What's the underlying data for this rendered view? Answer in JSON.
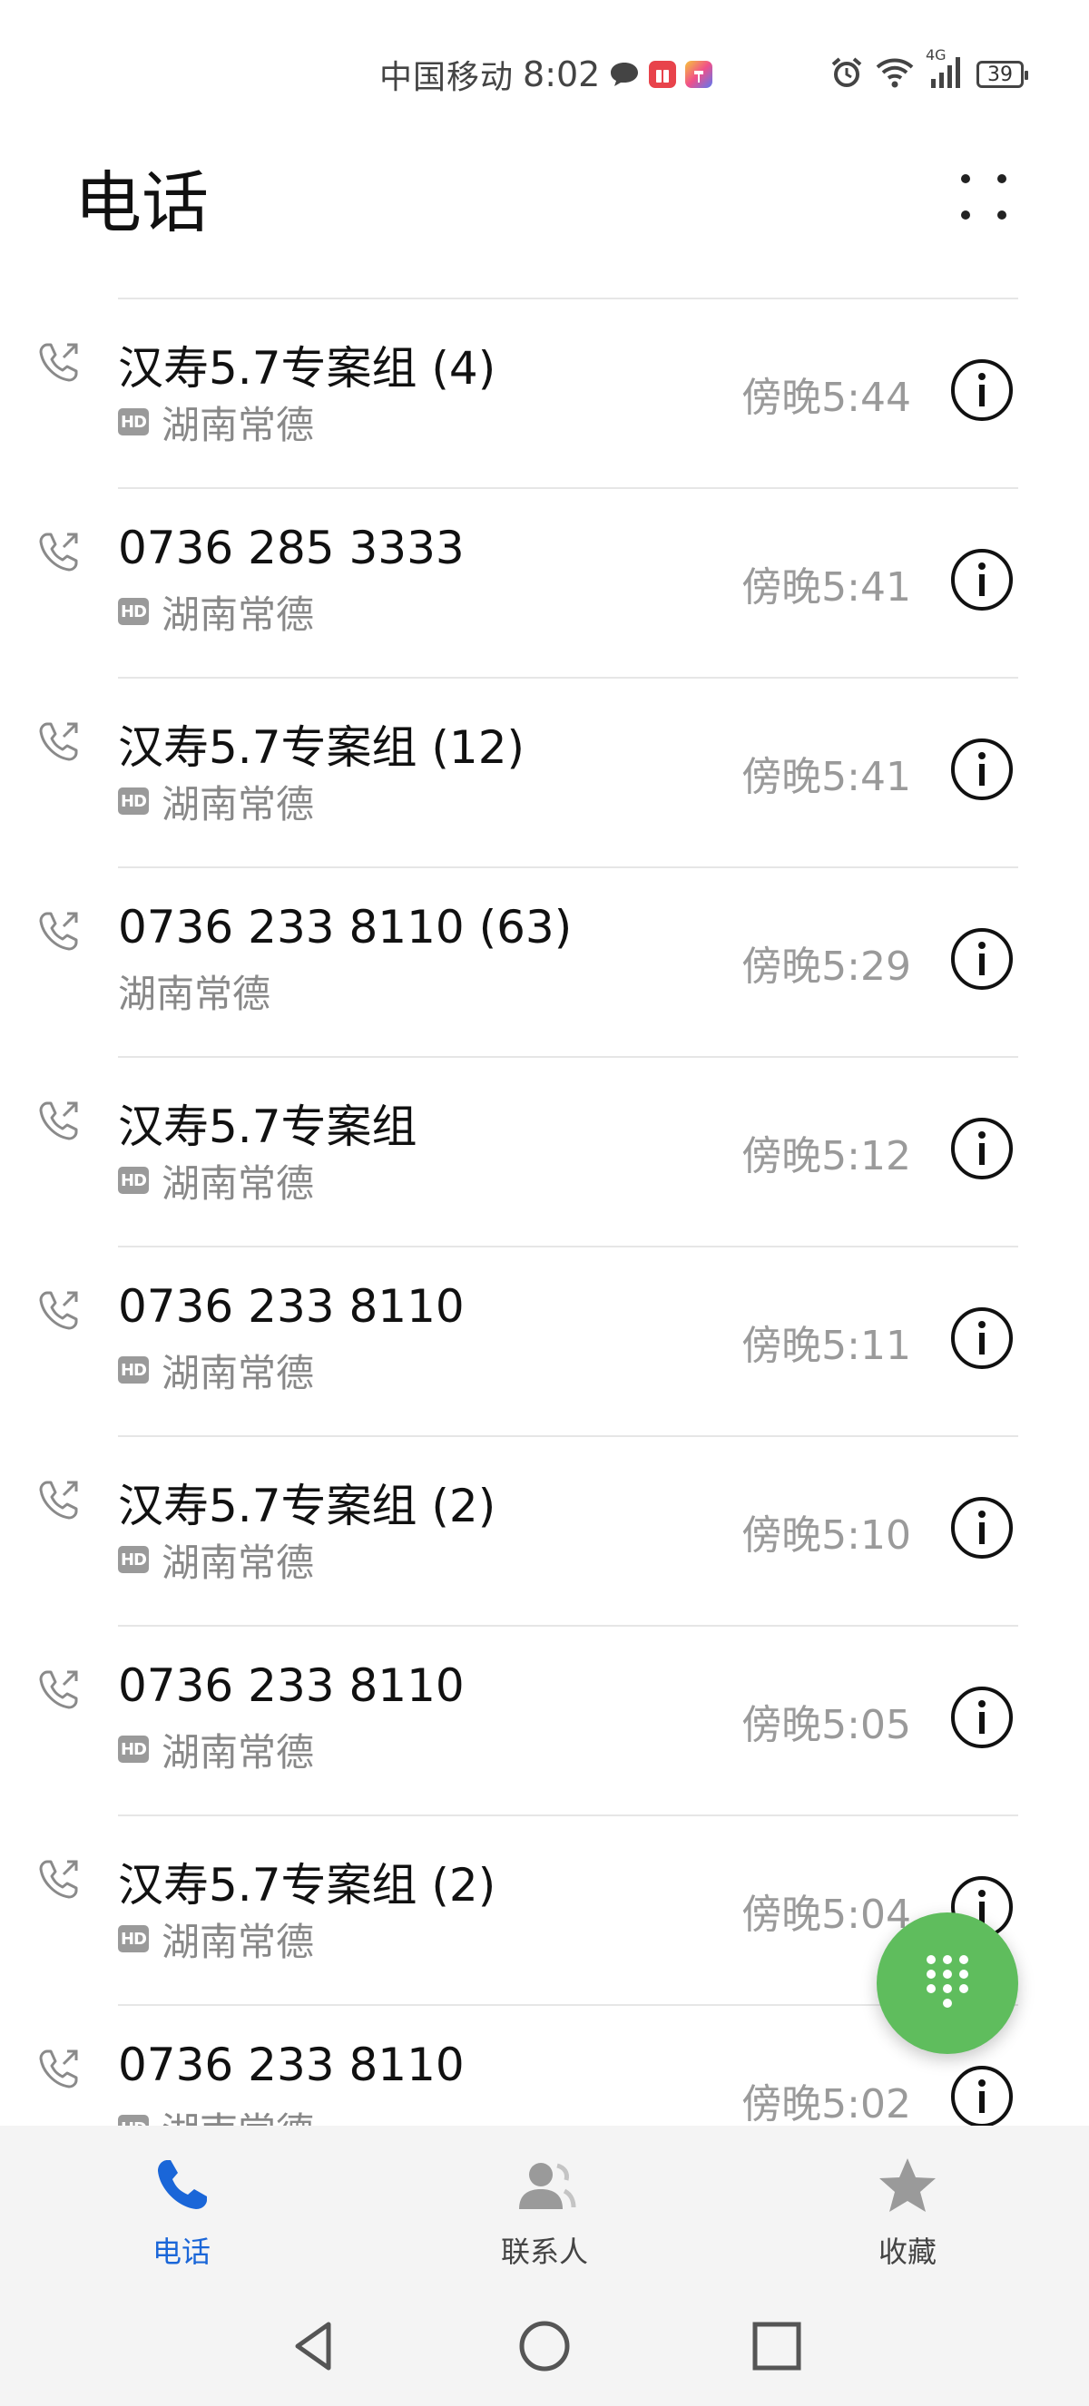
{
  "status_bar": {
    "carrier": "中国移动",
    "time": "8:02",
    "network": "4G",
    "battery": "39",
    "icons": [
      "message-icon",
      "red-app-icon",
      "colorful-app-icon",
      "alarm-icon",
      "wifi-icon",
      "signal-icon",
      "battery-icon"
    ]
  },
  "header": {
    "title": "电话",
    "menu_icon": "more-icon"
  },
  "calls": [
    {
      "name": "汉寿5.7专案组 (4)",
      "hd": "HD",
      "location": "湖南常德",
      "time": "傍晚5:44"
    },
    {
      "name": "0736 285 3333",
      "hd": "HD",
      "location": "湖南常德",
      "time": "傍晚5:41"
    },
    {
      "name": "汉寿5.7专案组 (12)",
      "hd": "HD",
      "location": "湖南常德",
      "time": "傍晚5:41"
    },
    {
      "name": "0736 233 8110 (63)",
      "hd": "",
      "location": "湖南常德",
      "time": "傍晚5:29"
    },
    {
      "name": "汉寿5.7专案组",
      "hd": "HD",
      "location": "湖南常德",
      "time": "傍晚5:12"
    },
    {
      "name": "0736 233 8110",
      "hd": "HD",
      "location": "湖南常德",
      "time": "傍晚5:11"
    },
    {
      "name": "汉寿5.7专案组 (2)",
      "hd": "HD",
      "location": "湖南常德",
      "time": "傍晚5:10"
    },
    {
      "name": "0736 233 8110",
      "hd": "HD",
      "location": "湖南常德",
      "time": "傍晚5:05"
    },
    {
      "name": "汉寿5.7专案组 (2)",
      "hd": "HD",
      "location": "湖南常德",
      "time": "傍晚5:04"
    },
    {
      "name": "0736 233 8110",
      "hd": "HD",
      "location": "湖南常德",
      "time": "傍晚5:02"
    }
  ],
  "fab": {
    "icon": "dialpad-icon"
  },
  "bottom_nav": [
    {
      "label": "电话",
      "icon": "phone-icon",
      "active": true
    },
    {
      "label": "联系人",
      "icon": "contacts-icon",
      "active": false
    },
    {
      "label": "收藏",
      "icon": "star-icon",
      "active": false
    }
  ],
  "system_nav": [
    "back-icon",
    "home-icon",
    "recents-icon"
  ],
  "colors": {
    "accent": "#1a66d8",
    "fab": "#5fbd5d",
    "secondary_text": "#9a9a9a"
  }
}
